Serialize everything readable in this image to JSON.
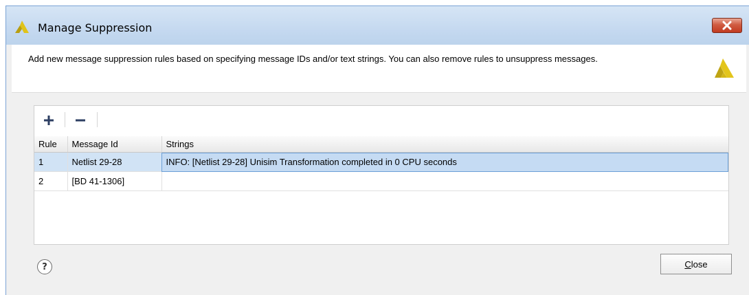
{
  "window": {
    "title": "Manage Suppression",
    "close_icon": "close-icon"
  },
  "header": {
    "description": "Add new message suppression rules based on specifying message IDs and/or text strings. You can also remove rules to unsuppress messages.",
    "logo_icon": "vivado-logo-icon"
  },
  "toolbar": {
    "add_icon": "plus-icon",
    "remove_icon": "minus-icon"
  },
  "table": {
    "columns": [
      "Rule",
      "Message Id",
      "Strings"
    ],
    "rows": [
      {
        "rule": "1",
        "message_id": "Netlist 29-28",
        "strings": "INFO: [Netlist 29-28] Unisim Transformation completed in 0 CPU seconds",
        "selected": true
      },
      {
        "rule": "2",
        "message_id": "[BD 41-1306]",
        "strings": "",
        "selected": false
      }
    ]
  },
  "footer": {
    "help_label": "?",
    "close_mnemonic": "C",
    "close_rest": "lose"
  },
  "colors": {
    "accent_yellow": "#d9c21a",
    "selection": "#d1e3f5",
    "close_red": "#c23a20"
  }
}
